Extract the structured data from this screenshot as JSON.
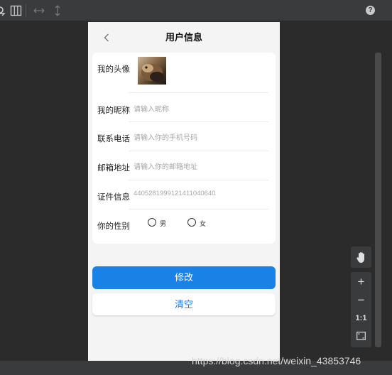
{
  "nav": {
    "title": "用户信息"
  },
  "profile": {
    "avatar_label": "我的头像",
    "nickname_label": "我的昵称",
    "nickname_placeholder": "请输入昵称",
    "phone_label": "联系电话",
    "phone_placeholder": "请输入你的手机号码",
    "email_label": "邮箱地址",
    "email_placeholder": "请输入你的邮箱地址",
    "id_label": "证件信息",
    "id_value": "440528199912141104064​0",
    "gender_label": "你的性别",
    "gender_options": [
      "男",
      "女"
    ]
  },
  "buttons": {
    "modify": "修改",
    "clear": "清空"
  },
  "tools": {
    "actual_size": "1:1"
  },
  "watermark": "https://blog.csdn.net/weixin_43853746",
  "colors": {
    "primary": "#1a82e6",
    "page_bg": "#f4f4f4",
    "ide_bg": "#2b2b2b"
  }
}
